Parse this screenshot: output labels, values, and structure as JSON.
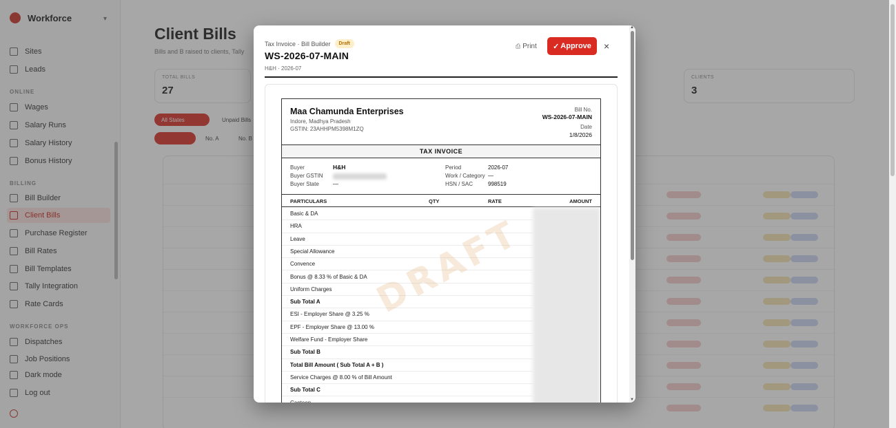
{
  "sidebar": {
    "brand": "Workforce",
    "sections": [
      "ONLINE",
      "BILLING",
      "WORKFORCE OPS"
    ],
    "items": [
      {
        "label": "Sites"
      },
      {
        "label": "Leads"
      },
      {
        "label": "Wages"
      },
      {
        "label": "Salary Runs"
      },
      {
        "label": "Salary History"
      },
      {
        "label": "Bonus History"
      },
      {
        "label": "Bill Builder"
      },
      {
        "label": "Client Bills"
      },
      {
        "label": "Purchase Register"
      },
      {
        "label": "Bill Rates"
      },
      {
        "label": "Bill Templates"
      },
      {
        "label": "Tally Integration"
      },
      {
        "label": "Rate Cards"
      },
      {
        "label": "Dispatches"
      },
      {
        "label": "Job Positions"
      },
      {
        "label": "Dark mode"
      },
      {
        "label": "Log out"
      }
    ]
  },
  "main": {
    "title": "Client Bills",
    "subtitle": "Bills and B raised to clients, Tally",
    "stats": [
      {
        "label": "TOTAL BILLS",
        "value": "27"
      },
      {
        "label": "CLIENTS",
        "value": "3"
      }
    ],
    "filters": [
      "All States",
      "Unpaid Bills",
      "No. A",
      "No. B"
    ]
  },
  "modal": {
    "breadcrumb": "Tax Invoice · Bill Builder",
    "status_badge": "Draft",
    "bill_title": "WS-2026-07-MAIN",
    "bill_subtitle": "H&H · 2026-07",
    "print_label": "Print",
    "approve_label": "Approve",
    "close_glyph": "×",
    "print_icon": "printer-icon",
    "approve_icon": "check-icon",
    "invoice": {
      "company_name": "Maa Chamunda Enterprises",
      "company_address": "Indore, Madhya Pradesh",
      "company_gstin": "GSTIN: 23AHHPM5398M1ZQ",
      "bill_no_label": "Bill No.",
      "bill_no": "WS-2026-07-MAIN",
      "date_label": "Date",
      "date": "1/8/2026",
      "heading": "TAX INVOICE",
      "buyer_label": "Buyer",
      "buyer": "H&H",
      "buyer_gstin_label": "Buyer GSTIN",
      "buyer_state_label": "Buyer State",
      "buyer_state": "—",
      "period_label": "Period",
      "period": "2026-07",
      "work_label": "Work / Category",
      "work": "—",
      "hsn_label": "HSN / SAC",
      "hsn": "998519",
      "columns": {
        "particulars": "PARTICULARS",
        "qty": "QTY",
        "rate": "RATE",
        "amount": "AMOUNT"
      },
      "rows": [
        {
          "label": "Basic & DA",
          "bold": false
        },
        {
          "label": "HRA",
          "bold": false
        },
        {
          "label": "Leave",
          "bold": false
        },
        {
          "label": "Special Allowance",
          "bold": false
        },
        {
          "label": "Convence",
          "bold": false
        },
        {
          "label": "Bonus @ 8.33 % of Basic & DA",
          "bold": false
        },
        {
          "label": "Uniform Charges",
          "bold": false
        },
        {
          "label": "Sub Total A",
          "bold": true
        },
        {
          "label": "ESI - Employer Share @ 3.25 %",
          "bold": false
        },
        {
          "label": "EPF - Employer Share @ 13.00 %",
          "bold": false
        },
        {
          "label": "Welfare Fund - Employer Share",
          "bold": false
        },
        {
          "label": "Sub Total B",
          "bold": true
        },
        {
          "label": "Total Bill Amount ( Sub Total A + B )",
          "bold": true
        },
        {
          "label": "Service Charges @ 8.00 % of Bill Amount",
          "bold": false
        },
        {
          "label": "Sub Total C",
          "bold": true
        },
        {
          "label": "Canteen",
          "bold": false
        }
      ],
      "watermark": "DRAFT"
    }
  },
  "colors": {
    "accent": "#d92b22",
    "badge_bg": "#fdefc9",
    "badge_fg": "#b66d00"
  }
}
